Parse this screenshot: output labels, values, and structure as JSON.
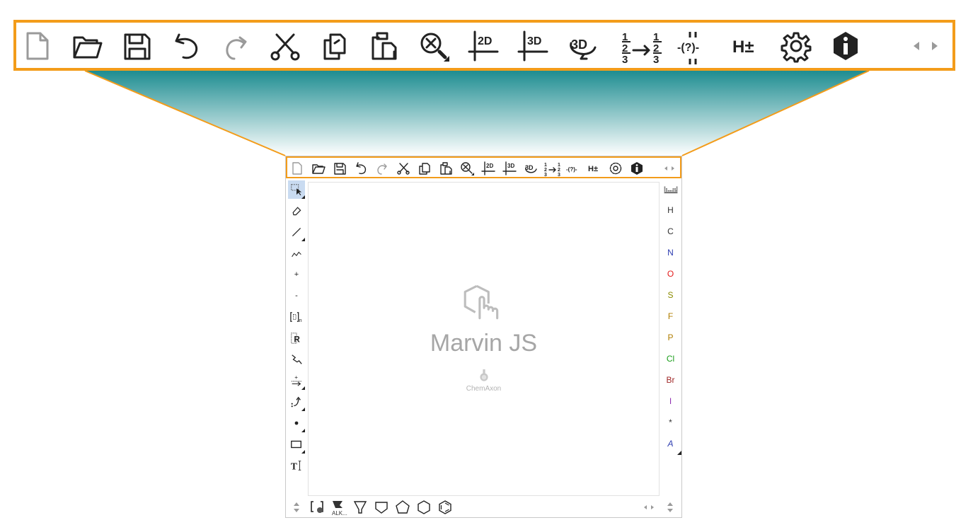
{
  "toolbar": {
    "items": [
      {
        "name": "new-document",
        "label": ""
      },
      {
        "name": "open",
        "label": ""
      },
      {
        "name": "save",
        "label": ""
      },
      {
        "name": "undo",
        "label": ""
      },
      {
        "name": "redo",
        "label": ""
      },
      {
        "name": "cut",
        "label": ""
      },
      {
        "name": "copy",
        "label": ""
      },
      {
        "name": "paste",
        "label": ""
      },
      {
        "name": "zoom",
        "label": ""
      },
      {
        "name": "clean-2d",
        "label": "2D"
      },
      {
        "name": "clean-3d",
        "label": "3D"
      },
      {
        "name": "rotate-3d",
        "label": "3D"
      },
      {
        "name": "numbering",
        "label": "1 2 3 → 1 2 3"
      },
      {
        "name": "query",
        "label": "-(?)-"
      },
      {
        "name": "hydrogens",
        "label": "H±"
      },
      {
        "name": "settings",
        "label": ""
      },
      {
        "name": "about",
        "label": ""
      }
    ],
    "scroll_arrows": "◂ ▸"
  },
  "left_tools": [
    "select",
    "erase",
    "single-bond",
    "chain",
    "+",
    "-",
    "bracket",
    "R-group",
    "reaction-arrow",
    "charge-arrow",
    "electron-flow",
    "radical",
    "rectangle",
    "text"
  ],
  "left_tool_labels": {
    "plus": "+",
    "minus": "-",
    "bracket_n": "n",
    "rgroup": "R",
    "text": "T"
  },
  "elements": {
    "periodic_icon": "periodic-table",
    "items": [
      {
        "symbol": "H",
        "color": "#333333"
      },
      {
        "symbol": "C",
        "color": "#333333"
      },
      {
        "symbol": "N",
        "color": "#2c3bb0"
      },
      {
        "symbol": "O",
        "color": "#e31b1b"
      },
      {
        "symbol": "S",
        "color": "#8b8b00"
      },
      {
        "symbol": "F",
        "color": "#b07d00"
      },
      {
        "symbol": "P",
        "color": "#b07d00"
      },
      {
        "symbol": "Cl",
        "color": "#1a9e1a"
      },
      {
        "symbol": "Br",
        "color": "#a02828"
      },
      {
        "symbol": "I",
        "color": "#8f2fb0"
      },
      {
        "symbol": "*",
        "color": "#333333"
      },
      {
        "symbol": "A",
        "color": "#2c3bb0"
      }
    ]
  },
  "canvas": {
    "title": "Marvin JS",
    "company": "ChemAxon"
  },
  "bottom_templates": {
    "labels": {
      "alkane": "ALK..."
    },
    "items": [
      "bracket-template",
      "alkane-template",
      "cyclopropane",
      "cyclobutane",
      "cyclopentane",
      "cyclohexane",
      "benzene"
    ]
  },
  "colors": {
    "accent": "#f39c1a",
    "teal": "#1e8d91",
    "selected": "#c9dbf1"
  }
}
